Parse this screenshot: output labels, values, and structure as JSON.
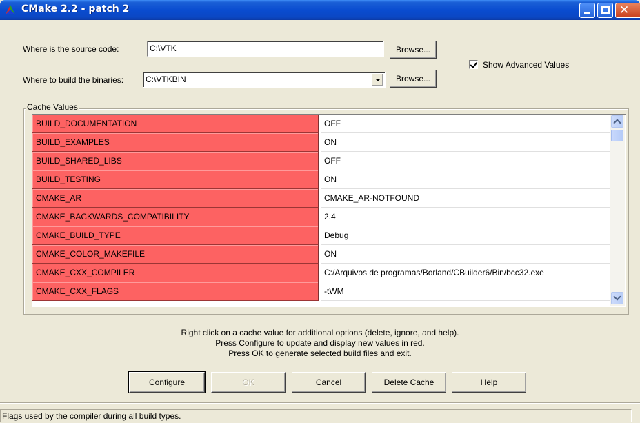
{
  "window": {
    "title": "CMake 2.2 - patch 2",
    "controls": {
      "minimize": "minimize-icon",
      "maximize": "maximize-icon",
      "close": "close-icon"
    }
  },
  "source": {
    "label": "Where is the source code:",
    "value": "C:\\VTK",
    "browse": "Browse..."
  },
  "build": {
    "label": "Where to build the binaries:",
    "value": "C:\\VTKBIN",
    "browse": "Browse..."
  },
  "advanced": {
    "label": "Show Advanced Values",
    "checked": true
  },
  "cache": {
    "title": "Cache Values",
    "entries": [
      {
        "name": "BUILD_DOCUMENTATION",
        "value": "OFF"
      },
      {
        "name": "BUILD_EXAMPLES",
        "value": "ON"
      },
      {
        "name": "BUILD_SHARED_LIBS",
        "value": "OFF"
      },
      {
        "name": "BUILD_TESTING",
        "value": "ON"
      },
      {
        "name": "CMAKE_AR",
        "value": "CMAKE_AR-NOTFOUND"
      },
      {
        "name": "CMAKE_BACKWARDS_COMPATIBILITY",
        "value": "2.4"
      },
      {
        "name": "CMAKE_BUILD_TYPE",
        "value": "Debug"
      },
      {
        "name": "CMAKE_COLOR_MAKEFILE",
        "value": "ON"
      },
      {
        "name": "CMAKE_CXX_COMPILER",
        "value": "C:/Arquivos de programas/Borland/CBuilder6/Bin/bcc32.exe"
      },
      {
        "name": "CMAKE_CXX_FLAGS",
        "value": " -tWM"
      }
    ],
    "highlight_color": "#fd6262"
  },
  "help": {
    "line1": "Right click on a cache value for additional options (delete, ignore, and help).",
    "line2": "Press Configure to update and display new values in red.",
    "line3": "Press OK to generate selected build files and exit."
  },
  "buttons": {
    "configure": "Configure",
    "ok": "OK",
    "cancel": "Cancel",
    "delete_cache": "Delete Cache",
    "help": "Help"
  },
  "status": "Flags used by the compiler during all build types."
}
